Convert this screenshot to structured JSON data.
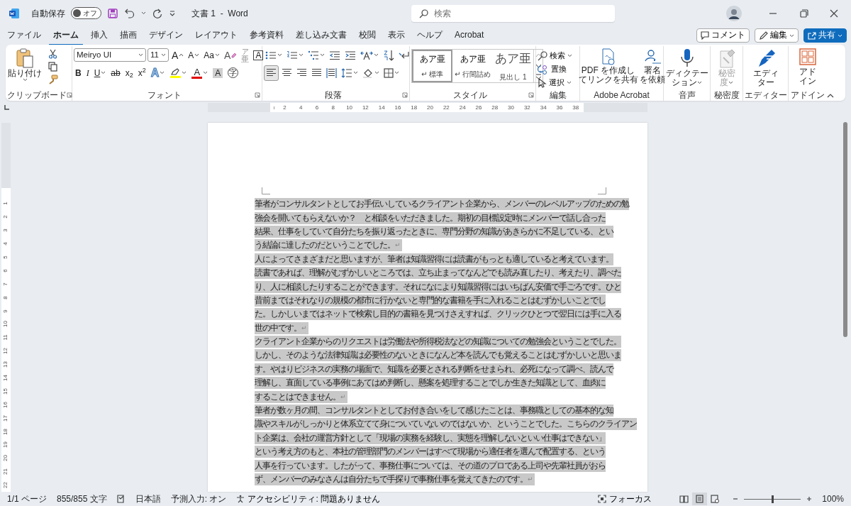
{
  "title_bar": {
    "autosave_label": "自動保存",
    "autosave": {
      "on": false,
      "label": "オフ"
    },
    "document_title": "文書 1  -  Word",
    "search": {
      "placeholder": "検索"
    }
  },
  "menu_tabs": [
    {
      "label": "ファイル",
      "selected": false
    },
    {
      "label": "ホーム",
      "selected": true
    },
    {
      "label": "挿入",
      "selected": false
    },
    {
      "label": "描画",
      "selected": false
    },
    {
      "label": "デザイン",
      "selected": false
    },
    {
      "label": "レイアウト",
      "selected": false
    },
    {
      "label": "参考資料",
      "selected": false
    },
    {
      "label": "差し込み文書",
      "selected": false
    },
    {
      "label": "校閲",
      "selected": false
    },
    {
      "label": "表示",
      "selected": false
    },
    {
      "label": "ヘルプ",
      "selected": false
    },
    {
      "label": "Acrobat",
      "selected": false
    }
  ],
  "actions": [
    {
      "label": "コメント",
      "kind": "comment"
    },
    {
      "label": "編集",
      "kind": "edit"
    },
    {
      "label": "共有",
      "kind": "share"
    }
  ],
  "ribbon": {
    "clipboard": {
      "label": "クリップボード",
      "paste": "貼り付け",
      "launcher": true
    },
    "font": {
      "label": "フォント",
      "launcher": true,
      "font_name": "Meiryo UI",
      "font_size": "11",
      "row1": [
        {
          "kind": "grow",
          "text": "A"
        },
        {
          "kind": "shrink",
          "text": "A"
        },
        {
          "kind": "case",
          "text": "Aa",
          "dropdown": true
        },
        {
          "kind": "clear",
          "text": "A"
        },
        {
          "kind": "phonetic",
          "text": "亜",
          "ruby": "ア"
        },
        {
          "kind": "border",
          "text": "A"
        }
      ],
      "row2": [
        {
          "kind": "bold",
          "text": "B"
        },
        {
          "kind": "italic",
          "text": "I"
        },
        {
          "kind": "underline",
          "text": "U",
          "dropdown": true
        },
        {
          "kind": "strike",
          "text": "ab"
        },
        {
          "kind": "sub",
          "text": "x$_{2}$"
        },
        {
          "kind": "super",
          "text": "x$^{2}$"
        },
        {
          "kind": "effect",
          "text": "A",
          "dropdown": true
        },
        {
          "kind": "highlight",
          "color": "#ffff00",
          "dropdown": true
        },
        {
          "kind": "color",
          "text": "A",
          "color": "#e00000",
          "dropdown": true
        },
        {
          "kind": "shading",
          "text": "A"
        },
        {
          "kind": "enclose",
          "text": "字"
        }
      ]
    },
    "paragraph": {
      "label": "段落",
      "launcher": true,
      "row1": [
        {
          "kind": "bullets",
          "dropdown": true
        },
        {
          "kind": "numbering",
          "dropdown": true
        },
        {
          "kind": "multilevel",
          "dropdown": true
        },
        {
          "kind": "outdent"
        },
        {
          "kind": "indent"
        },
        {
          "kind": "asian",
          "dropdown": true
        },
        {
          "kind": "sort"
        },
        {
          "kind": "marks"
        }
      ],
      "alignments": [
        {
          "kind": "left",
          "selected": true
        },
        {
          "kind": "center",
          "selected": false
        },
        {
          "kind": "right",
          "selected": false
        },
        {
          "kind": "justify",
          "selected": false
        },
        {
          "kind": "distribute",
          "selected": false
        }
      ],
      "row2": [
        {
          "kind": "spacing",
          "dropdown": true
        },
        {
          "kind": "fill",
          "dropdown": true
        },
        {
          "kind": "borders",
          "dropdown": true
        }
      ]
    },
    "styles": {
      "label": "スタイル",
      "launcher": true,
      "items": [
        {
          "sample": "あア亜",
          "mark": "↵",
          "name": "標準",
          "selected": true
        },
        {
          "sample": "あア亜",
          "mark": "↵",
          "name": "行間詰め",
          "selected": false
        },
        {
          "sample": "あア亜",
          "name": "見出し 1",
          "selected": false,
          "kind": "heading"
        }
      ]
    },
    "editing": {
      "label": "編集",
      "items": [
        {
          "kind": "find",
          "text": "検索",
          "dropdown": true
        },
        {
          "kind": "replace",
          "text": "置換",
          "dropdown": false
        },
        {
          "kind": "select",
          "text": "選択",
          "dropdown": true
        }
      ]
    },
    "big_groups": [
      {
        "label": "Adobe Acrobat",
        "buttons": [
          {
            "kind": "pdf",
            "lines": [
              "PDF を作成し",
              "てリンクを共有"
            ],
            "dropdown": false,
            "disabled": false
          },
          {
            "kind": "sign",
            "lines": [
              "署名",
              "を依頼"
            ],
            "dropdown": false,
            "disabled": false
          }
        ]
      },
      {
        "label": "音声",
        "buttons": [
          {
            "kind": "mic",
            "lines": [
              "ディクテー",
              "ション"
            ],
            "dropdown": true,
            "disabled": false
          }
        ]
      },
      {
        "label": "秘密度",
        "buttons": [
          {
            "kind": "sensitivity",
            "lines": [
              "秘密",
              "度"
            ],
            "dropdown": true,
            "disabled": true
          }
        ]
      },
      {
        "label": "エディター",
        "buttons": [
          {
            "kind": "editor",
            "lines": [
              "エディ",
              "ター"
            ],
            "dropdown": false,
            "disabled": false
          }
        ]
      },
      {
        "label": "アドイン",
        "buttons": [
          {
            "kind": "addins",
            "lines": [
              "アド",
              "イン"
            ],
            "dropdown": false,
            "disabled": false
          }
        ]
      }
    ]
  },
  "ruler": {
    "numbers": [
      "2",
      "4",
      "6",
      "8",
      "10",
      "12",
      "14",
      "16",
      "18",
      "20",
      "22",
      "24",
      "26",
      "28",
      "30",
      "32",
      "34",
      "36",
      "38"
    ]
  },
  "vertical_ruler": {
    "numbers": [
      "1",
      "2",
      "3",
      "4",
      "5",
      "6",
      "7",
      "8",
      "9",
      "10",
      "11",
      "12",
      "13",
      "14",
      "15",
      "16",
      "17",
      "18",
      "19",
      "20",
      "21",
      "22"
    ]
  },
  "document": {
    "paragraphs": [
      {
        "selected": true,
        "mark": "↵",
        "lines": [
          "筆者がコンサルタントとしてお手伝いしているクライアント企業から、メンバーのレベルアップのための勉",
          "強会を開いてもらえないか？　と相談をいただきました。期初の目標設定時にメンバーで話し合った",
          "結果、仕事をしていて自分たちを振り返ったときに、専門分野の知識があきらかに不足している、とい",
          "う結論に達したのだということでした。"
        ]
      },
      {
        "selected": true,
        "mark": "↵",
        "lines": [
          "人によってさまざまだと思いますが、筆者は知識習得には読書がもっとも適していると考えています。",
          "読書であれば、理解がむずかしいところでは、立ち止まってなんどでも読み直したり、考えたり、調べた",
          "り、人に相談したりすることができます。それになにより知識習得にはいちばん安価で手ごろです。ひと",
          "昔前まではそれなりの規模の都市に行かないと専門的な書籍を手に入れることはむずかしいことでし",
          "た。しかしいまではネットで検索し目的の書籍を見つけさえすれば、クリックひとつで翌日には手に入る",
          "世の中です。"
        ]
      },
      {
        "selected": true,
        "mark": "↵",
        "lines": [
          "クライアント企業からのリクエストは労働法や所得税法などの知識についての勉強会ということでした。",
          "しかし、そのような法律知識は必要性のないときになんど本を読んでも覚えることはむずかしいと思いま",
          "す。やはりビジネスの実務の場面で、知識を必要とされる判断をせまられ、必死になって調べ、読んで",
          "理解し、直面している事例にあてはめ判断し、懸案を処理することでしか生きた知識として、血肉に",
          "することはできません。"
        ]
      },
      {
        "selected": true,
        "mark": "↵",
        "lines": [
          "筆者が数ヶ月の間、コンサルタントとしてお付き合いをして感じたことは、事務職としての基本的な知",
          "識やスキルがしっかりと体系立てて身についていないのではないか、ということでした。こちらのクライアン",
          "ト企業は、会社の運営方針として「現場の実務を経験し、実態を理解しないといい仕事はできない」",
          "という考え方のもと、本社の管理部門のメンバーはすべて現場から適任者を選んで配置する、という",
          "人事を行っています。したがって、事務仕事については、その道のプロである上司や先輩社員がおら",
          "ず、メンバーのみなさんは自分たちで手探りで事務仕事を覚えてきたのです。"
        ]
      }
    ]
  },
  "status_bar": {
    "items": [
      {
        "kind": "text",
        "text": "1/1 ページ"
      },
      {
        "kind": "text",
        "text": "855/855 文字"
      },
      {
        "kind": "proofing"
      },
      {
        "kind": "text",
        "text": "日本語"
      },
      {
        "kind": "text",
        "text": "予測入力: オン"
      },
      {
        "kind": "accessibility",
        "text": "アクセシビリティ: 問題ありません"
      }
    ],
    "focus": "フォーカス",
    "views": [
      {
        "kind": "read",
        "selected": false
      },
      {
        "kind": "print",
        "selected": true
      },
      {
        "kind": "web",
        "selected": false
      }
    ],
    "zoom": {
      "level": 0.5,
      "reading": "100%"
    }
  }
}
